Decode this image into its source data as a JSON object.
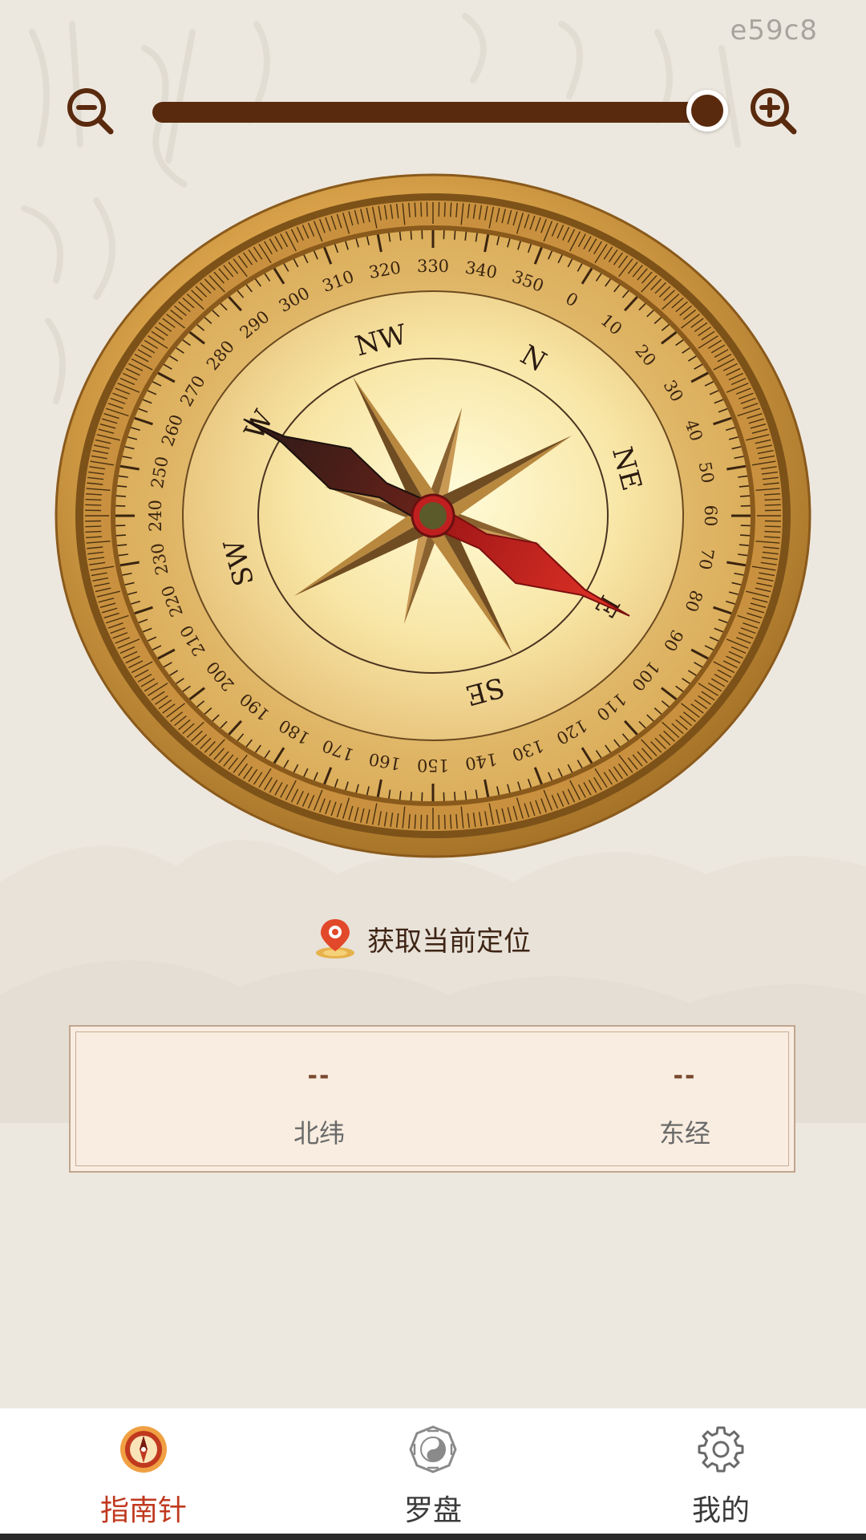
{
  "watermark": "e59c8",
  "zoom": {
    "zoom_out_icon": "zoom-out-icon",
    "zoom_in_icon": "zoom-in-icon",
    "level": 1.0
  },
  "compass": {
    "dial_labels": [
      "0",
      "10",
      "20",
      "30",
      "40",
      "50",
      "60",
      "70",
      "80",
      "90",
      "100",
      "110",
      "120",
      "130",
      "140",
      "150",
      "160",
      "170",
      "180",
      "190",
      "200",
      "210",
      "220",
      "230",
      "240",
      "250",
      "260",
      "270",
      "280",
      "290",
      "300",
      "310",
      "320",
      "330",
      "340",
      "350"
    ],
    "cardinals": [
      {
        "label": "N",
        "deg": 0
      },
      {
        "label": "NE",
        "deg": 45
      },
      {
        "label": "E",
        "deg": 90
      },
      {
        "label": "SE",
        "deg": 135
      },
      {
        "label": "SW",
        "deg": 225
      },
      {
        "label": "W",
        "deg": 270
      },
      {
        "label": "NW",
        "deg": 315
      }
    ],
    "needle_icon": "compass-needle"
  },
  "location": {
    "button_label": "获取当前定位",
    "icon": "location-pin-icon"
  },
  "coords": {
    "latitude_value": "--",
    "latitude_label": "北纬",
    "longitude_value": "--",
    "longitude_label": "东经"
  },
  "tabbar": {
    "tabs": [
      {
        "label": "指南针",
        "icon": "compass-tab-icon",
        "active": true,
        "color": "#c0391e"
      },
      {
        "label": "罗盘",
        "icon": "bagua-icon",
        "active": false
      },
      {
        "label": "我的",
        "icon": "gear-icon",
        "active": false
      }
    ]
  },
  "colors": {
    "background": "#ede8df",
    "slider": "#5a2a0e",
    "accent": "#c0391e"
  }
}
